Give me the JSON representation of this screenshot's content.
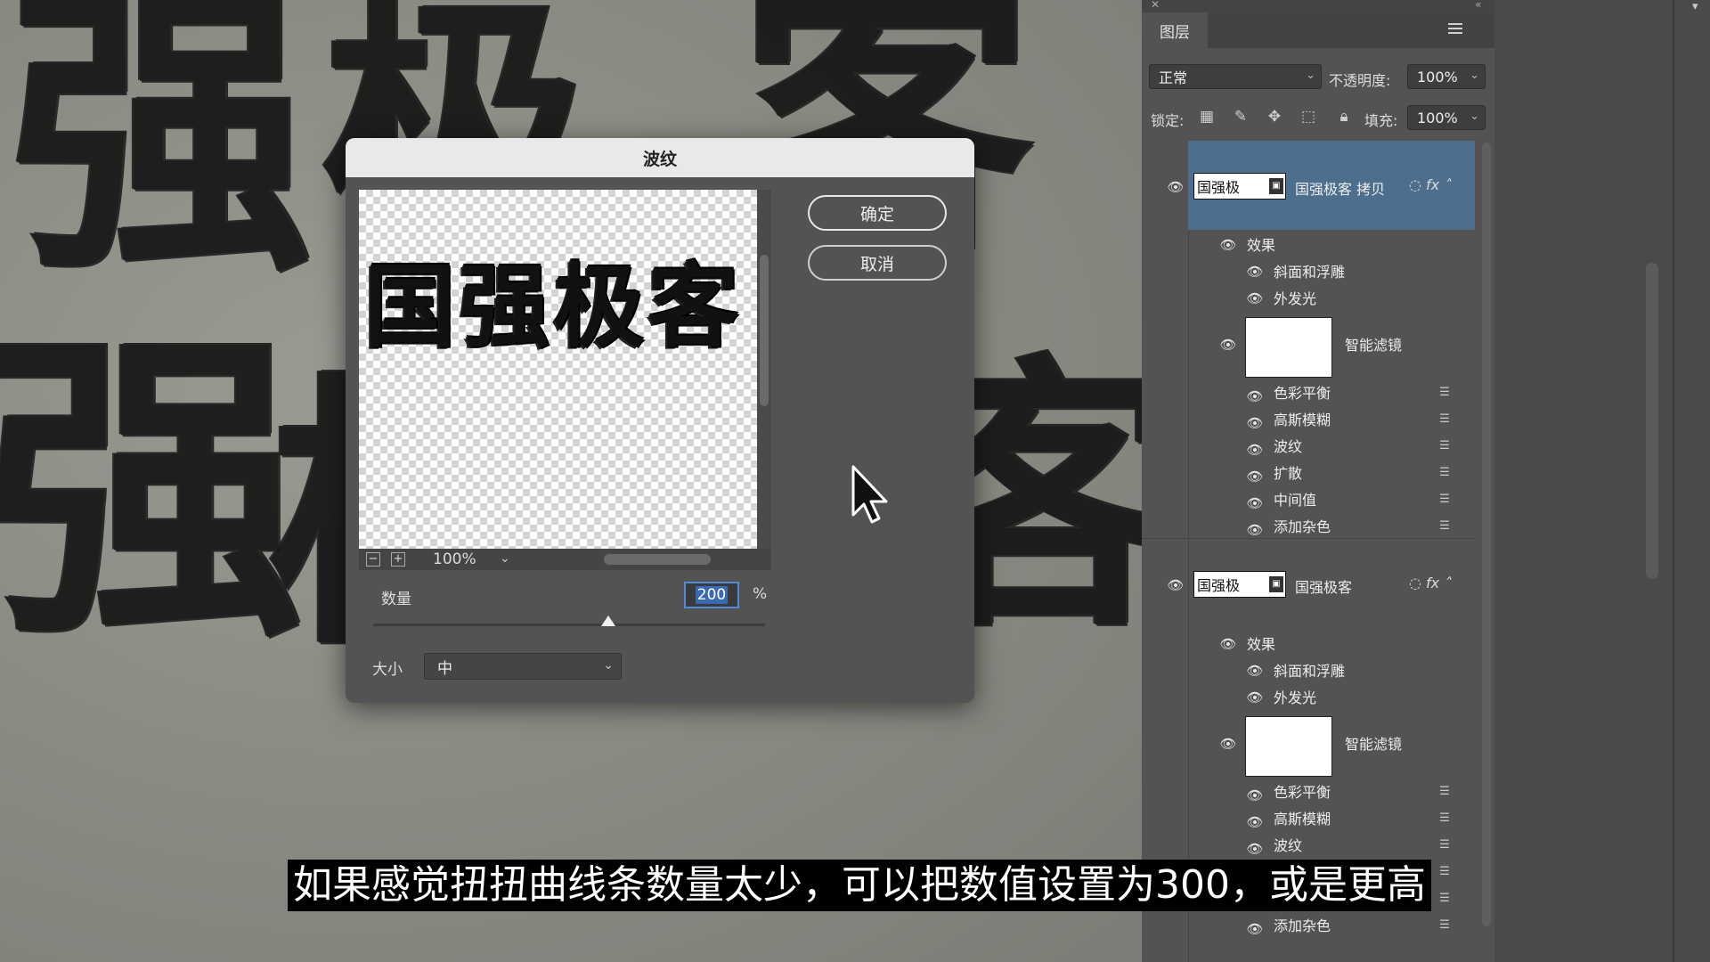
{
  "background": {
    "chars": [
      "强",
      "极",
      "客",
      "强",
      "极",
      "客"
    ]
  },
  "layers_panel": {
    "tab_label": "图层",
    "blend_mode": "正常",
    "opacity_label": "不透明度:",
    "opacity_value": "100%",
    "lock_label": "锁定:",
    "fill_label": "填充:",
    "fill_value": "100%",
    "layers": [
      {
        "name": "国强极客 拷贝",
        "thumb_text": "国强极",
        "selected": true,
        "effects_label": "效果",
        "effects": [
          "斜面和浮雕",
          "外发光"
        ],
        "smart_filter_label": "智能滤镜",
        "filters": [
          "色彩平衡",
          "高斯模糊",
          "波纹",
          "扩散",
          "中间值",
          "添加杂色"
        ]
      },
      {
        "name": "国强极客",
        "thumb_text": "国强极",
        "selected": false,
        "effects_label": "效果",
        "effects": [
          "斜面和浮雕",
          "外发光"
        ],
        "smart_filter_label": "智能滤镜",
        "filters": [
          "色彩平衡",
          "高斯模糊",
          "波纹",
          "",
          "",
          "添加杂色"
        ]
      }
    ],
    "fx_label": "fx"
  },
  "dialog": {
    "title": "波纹",
    "ok_label": "确定",
    "cancel_label": "取消",
    "preview_text": "国强极客",
    "zoom_value": "100%",
    "amount_label": "数量",
    "amount_value": "200",
    "amount_unit": "%",
    "amount_slider_fraction": 0.6,
    "size_label": "大小",
    "size_value": "中"
  },
  "subtitle": "如果感觉扭扭曲线条数量太少，可以把数值设置为300，或是更高",
  "colors": {
    "panel_bg": "#535353",
    "selected_row": "#4e6e8e",
    "focus_blue": "#4f8bd6"
  }
}
